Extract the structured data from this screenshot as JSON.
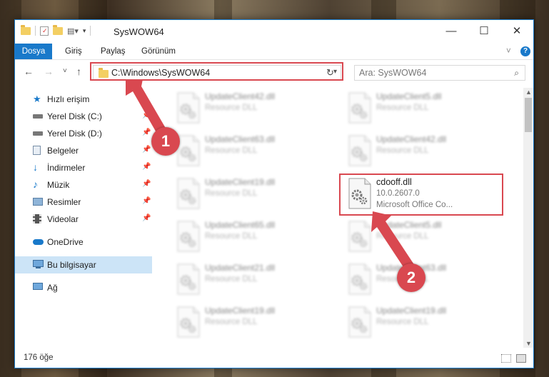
{
  "window": {
    "title": "SysWOW64",
    "minimize": "—",
    "maximize": "☐",
    "close": "✕"
  },
  "ribbon": {
    "tabs": [
      "Dosya",
      "Giriş",
      "Paylaş",
      "Görünüm"
    ],
    "expand_icon": "˅",
    "help_icon": "?"
  },
  "navigation": {
    "back": "←",
    "forward": "→",
    "recent": "˅",
    "up": "↑",
    "address": "C:\\Windows\\SysWOW64",
    "refresh": "↻",
    "search_placeholder": "Ara: SysWOW64",
    "search_icon": "⌕"
  },
  "sidebar": {
    "items": [
      {
        "label": "Hızlı erişim",
        "icon": "star-icon",
        "pinned": false
      },
      {
        "label": "Yerel Disk (C:)",
        "icon": "drive-icon",
        "pinned": true
      },
      {
        "label": "Yerel Disk (D:)",
        "icon": "drive-icon",
        "pinned": true
      },
      {
        "label": "Belgeler",
        "icon": "documents-icon",
        "pinned": true
      },
      {
        "label": "İndirmeler",
        "icon": "download-icon",
        "pinned": true
      },
      {
        "label": "Müzik",
        "icon": "music-icon",
        "pinned": true
      },
      {
        "label": "Resimler",
        "icon": "pictures-icon",
        "pinned": true
      },
      {
        "label": "Videolar",
        "icon": "videos-icon",
        "pinned": true
      },
      {
        "label": "OneDrive",
        "icon": "cloud-icon",
        "pinned": false
      },
      {
        "label": "Bu bilgisayar",
        "icon": "computer-icon",
        "pinned": false
      },
      {
        "label": "Ağ",
        "icon": "network-icon",
        "pinned": false
      }
    ]
  },
  "files": [
    {
      "name": "UpdateClient42.dll",
      "desc": "Resource DLL"
    },
    {
      "name": "UpdateClient5.dll",
      "desc": "Resource DLL"
    },
    {
      "name": "UpdateClient63.dll",
      "desc": "Resource DLL"
    },
    {
      "name": "UpdateClient42.dll",
      "desc": "Resource DLL"
    },
    {
      "name": "UpdateClient19.dll",
      "desc": "Resource DLL"
    },
    {
      "name": "UpdateClient65.dll",
      "desc": "Resource DLL"
    },
    {
      "name": "UpdateClient5.dll",
      "desc": "Resource DLL"
    },
    {
      "name": "UpdateClient21.dll",
      "desc": "Resource DLL"
    },
    {
      "name": "UpdateClient63.dll",
      "desc": "Resource DLL"
    },
    {
      "name": "UpdateClient19.dll",
      "desc": "Resource DLL"
    },
    {
      "name": "UpdateClient19.dll",
      "desc": "Resource DLL"
    }
  ],
  "highlighted_file": {
    "name": "cdooff.dll",
    "version": "10.0.2607.0",
    "company": "Microsoft Office Co..."
  },
  "status": {
    "item_count": "176 öğe"
  },
  "callouts": [
    "1",
    "2"
  ],
  "colors": {
    "accent": "#1979ca",
    "annotation": "#d94850",
    "selection": "#cce4f7"
  }
}
